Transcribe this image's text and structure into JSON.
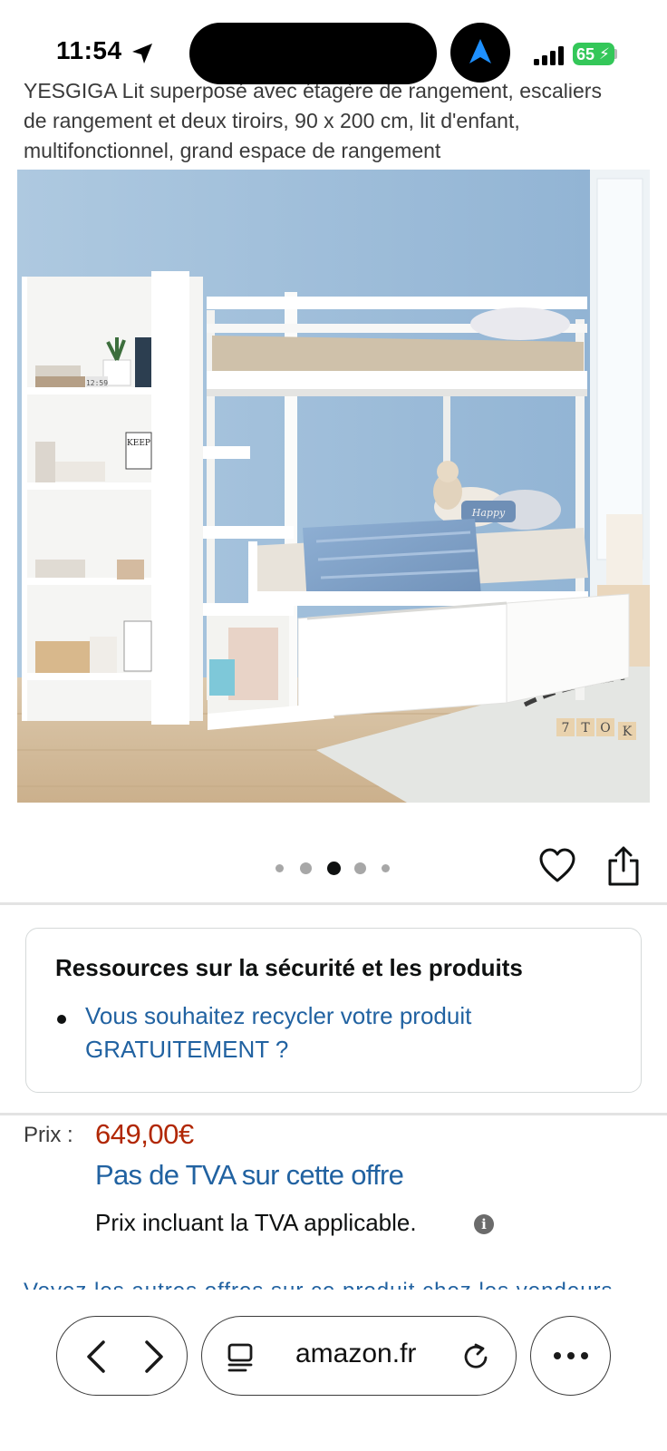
{
  "status_bar": {
    "time": "11:54",
    "battery_level": "65",
    "icons": [
      "location-arrow-icon",
      "navigation-icon",
      "signal-icon",
      "battery-icon"
    ]
  },
  "product": {
    "title": "YESGIGA Lit superposé avec étagère de rangement, escaliers de rangement et deux tiroirs, 90 x 200 cm, lit d'enfant, multifonctionnel, grand espace de rangement",
    "image_subject": "white bunk bed with storage shelf, stairs and drawers",
    "image_text": {
      "clock": "12:59",
      "book": "KEEP",
      "pillow": "Happy",
      "blocks": [
        "7",
        "T",
        "O",
        "K"
      ]
    }
  },
  "carousel": {
    "image_count": 5,
    "active_index": 2
  },
  "safety": {
    "title": "Ressources sur la sécurité et les produits",
    "link": "Vous souhaitez recycler votre produit GRATUITEMENT ?"
  },
  "price": {
    "label": "Prix :",
    "value": "649,00€",
    "vat_link": "Pas de TVA sur cette offre",
    "vat_note": "Prix incluant la TVA applicable.",
    "info_symbol": "i",
    "partial_text": "Voyez les autres offres sur ce produit chez les vendeurs"
  },
  "browser": {
    "url": "amazon.fr"
  },
  "colors": {
    "price": "#b12704",
    "link": "#2162a1",
    "battery": "#34c759",
    "nav_arrow": "#1e90ff"
  }
}
